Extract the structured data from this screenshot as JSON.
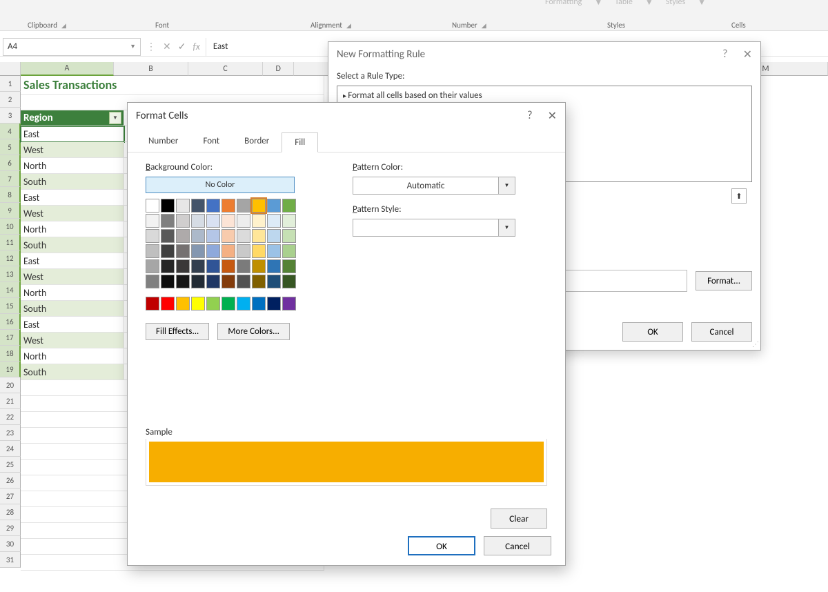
{
  "ribbon": {
    "clipboard": "Clipboard",
    "font": "Font",
    "alignment": "Alignment",
    "number": "Number",
    "styles": "Styles",
    "cells": "Cells",
    "formatting_hint": "Formatting",
    "table_hint": "Table",
    "styles_hint": "Styles"
  },
  "formula": {
    "cell_ref": "A4",
    "fx": "fx",
    "value": "East"
  },
  "columns": [
    "A",
    "B",
    "C",
    "D",
    "M"
  ],
  "rows": [
    1,
    2,
    3,
    4,
    5,
    6,
    7,
    8,
    9,
    10,
    11,
    12,
    13,
    14,
    15,
    16,
    17,
    18,
    19,
    20,
    21,
    22,
    23,
    24,
    25,
    26,
    27,
    28,
    29,
    30,
    31
  ],
  "sheet": {
    "title": "Sales Transactions",
    "header_region": "Region",
    "data": [
      "East",
      "West",
      "North",
      "South",
      "East",
      "West",
      "North",
      "South",
      "East",
      "West",
      "North",
      "South",
      "East",
      "West",
      "North",
      "South"
    ]
  },
  "dlg_rule": {
    "title": "New Formatting Rule",
    "select_label": "Select a Rule Type:",
    "rule0": "Format all cells based on their values",
    "format_btn": "Format...",
    "ok": "OK",
    "cancel": "Cancel"
  },
  "dlg_format": {
    "title": "Format Cells",
    "tab_number": "Number",
    "tab_font": "Font",
    "tab_border": "Border",
    "tab_fill": "Fill",
    "bg_label": "Background Color:",
    "no_color": "No Color",
    "pattern_color_label": "Pattern Color:",
    "pattern_auto": "Automatic",
    "pattern_style_label": "Pattern Style:",
    "fill_effects": "Fill Effects...",
    "more_colors": "More Colors...",
    "sample_label": "Sample",
    "clear": "Clear",
    "ok": "OK",
    "cancel": "Cancel"
  },
  "theme_colors": [
    "#ffffff",
    "#000000",
    "#e7e6e6",
    "#44546a",
    "#4472c4",
    "#ed7d31",
    "#a5a5a5",
    "#ffc000",
    "#5b9bd5",
    "#70ad47",
    "#f2f2f2",
    "#7f7f7f",
    "#d0cece",
    "#d6dce4",
    "#d9e1f2",
    "#fce4d6",
    "#ededed",
    "#fff2cc",
    "#ddebf7",
    "#e2efda",
    "#d9d9d9",
    "#595959",
    "#aeaaaa",
    "#acb9ca",
    "#b4c6e7",
    "#f8cbad",
    "#dbdbdb",
    "#ffe699",
    "#bdd7ee",
    "#c6e0b4",
    "#bfbfbf",
    "#404040",
    "#757171",
    "#8497b0",
    "#8ea9db",
    "#f4b084",
    "#c9c9c9",
    "#ffd966",
    "#9bc2e6",
    "#a9d08e",
    "#a6a6a6",
    "#262626",
    "#3a3838",
    "#333f4f",
    "#305496",
    "#c65911",
    "#7b7b7b",
    "#bf8f00",
    "#2f75b5",
    "#548235",
    "#808080",
    "#0d0d0d",
    "#161616",
    "#222b35",
    "#203764",
    "#833c0c",
    "#525252",
    "#806000",
    "#1f4e78",
    "#375623"
  ],
  "standard_colors": [
    "#c00000",
    "#ff0000",
    "#ffc000",
    "#ffff00",
    "#92d050",
    "#00b050",
    "#00b0f0",
    "#0070c0",
    "#002060",
    "#7030a0"
  ],
  "selected_swatch": "#ffc000",
  "sample_color": "#f7ae00"
}
